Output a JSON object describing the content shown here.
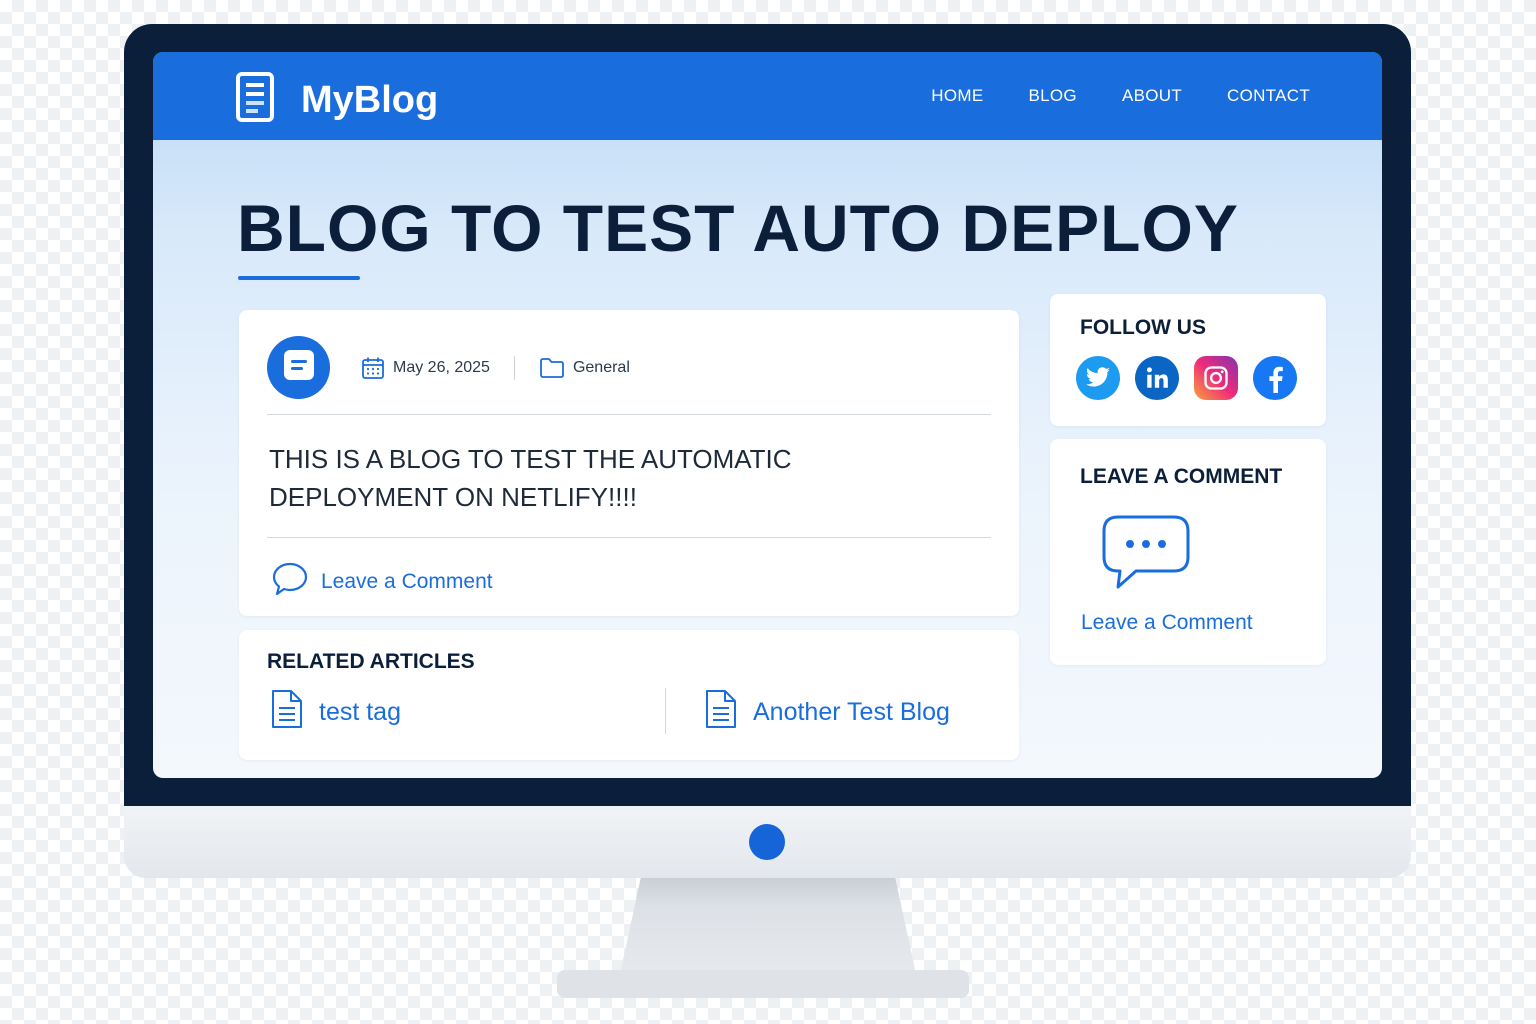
{
  "brand": {
    "name": "MyBlog",
    "icon": "document-icon"
  },
  "nav": {
    "items": [
      "HOME",
      "BLOG",
      "ABOUT",
      "CONTACT"
    ]
  },
  "post": {
    "title": "BLOG TO TEST AUTO DEPLOY",
    "date": "May 26, 2025",
    "category": "General",
    "body": "THIS IS A BLOG TO TEST THE AUTOMATIC DEPLOYMENT ON NETLIFY!!!!",
    "comment_link": "Leave a Comment"
  },
  "related": {
    "title": "RELATED ARTICLES",
    "items": [
      "test tag",
      "Another Test Blog"
    ]
  },
  "sidebar": {
    "follow_title": "FOLLOW US",
    "socials": [
      "twitter-icon",
      "linkedin-icon",
      "instagram-icon",
      "facebook-icon"
    ],
    "comment_title": "LEAVE A COMMENT",
    "comment_link": "Leave a Comment"
  },
  "colors": {
    "primary": "#1a6ddd",
    "bezel": "#0b1f3a",
    "twitter": "#1d9bf0",
    "linkedin": "#0a66c2",
    "facebook": "#1877f2"
  }
}
